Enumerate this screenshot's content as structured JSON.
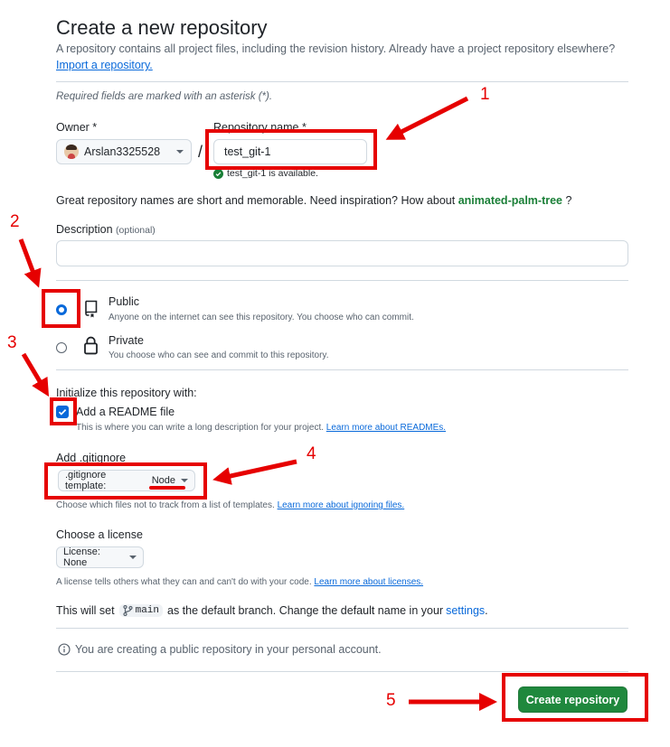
{
  "header": {
    "title": "Create a new repository",
    "subtitle": "A repository contains all project files, including the revision history. Already have a project repository elsewhere?",
    "import_link": "Import a repository."
  },
  "required_note": "Required fields are marked with an asterisk (*).",
  "owner": {
    "label": "Owner *",
    "value": "Arslan3325528"
  },
  "slash": "/",
  "repo_name": {
    "label": "Repository name *",
    "value": "test_git-1",
    "status": "test_git-1 is available."
  },
  "suggestion": {
    "text": "Great repository names are short and memorable. Need inspiration? How about",
    "name": "animated-palm-tree",
    "end": "?"
  },
  "description": {
    "label": "Description",
    "optional": "(optional)",
    "value": ""
  },
  "visibility": {
    "public": {
      "title": "Public",
      "desc": "Anyone on the internet can see this repository. You choose who can commit.",
      "selected": true
    },
    "private": {
      "title": "Private",
      "desc": "You choose who can see and commit to this repository.",
      "selected": false
    }
  },
  "initialize": {
    "heading": "Initialize this repository with:",
    "readme_label": "Add a README file",
    "readme_checked": true,
    "readme_desc": "This is where you can write a long description for your project.",
    "readme_link": "Learn more about READMEs."
  },
  "gitignore": {
    "heading": "Add .gitignore",
    "prefix": ".gitignore template:",
    "value": "Node",
    "desc": "Choose which files not to track from a list of templates.",
    "link": "Learn more about ignoring files."
  },
  "license": {
    "heading": "Choose a license",
    "button": "License: None",
    "desc": "A license tells others what they can and can't do with your code.",
    "link": "Learn more about licenses."
  },
  "branch": {
    "prefix": "This will set",
    "name": "main",
    "middle": "as the default branch. Change the default name in your",
    "link": "settings",
    "end": "."
  },
  "notice": "You are creating a public repository in your personal account.",
  "submit": "Create repository",
  "annotations": {
    "n1": "1",
    "n2": "2",
    "n3": "3",
    "n4": "4",
    "n5": "5",
    "color": "#e60000"
  },
  "colors": {
    "link": "#0969da",
    "success": "#1a7f37",
    "primary_button": "#1f883d"
  }
}
